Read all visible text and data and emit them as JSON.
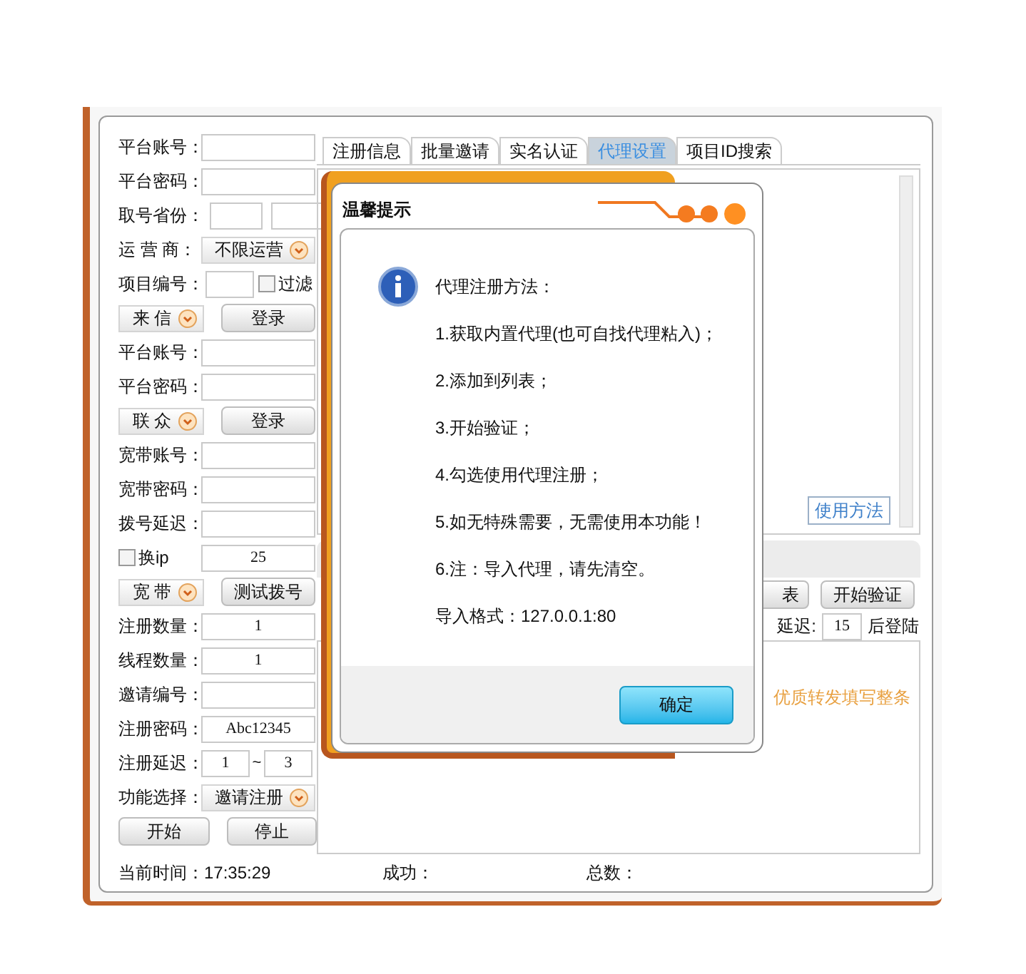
{
  "left_panel": {
    "rows": [
      {
        "kind": "field",
        "label": "平台账号："
      },
      {
        "kind": "field",
        "label": "平台密码："
      },
      {
        "kind": "pair",
        "label": "取号省份："
      },
      {
        "kind": "select",
        "label": "运 营 商：",
        "value": "不限运营"
      },
      {
        "kind": "field_check",
        "label": "项目编号：",
        "check_label": "过滤",
        "checked": false
      },
      {
        "kind": "select_button",
        "select": "来 信",
        "button": "登录"
      },
      {
        "kind": "field",
        "label": "平台账号："
      },
      {
        "kind": "field",
        "label": "平台密码："
      },
      {
        "kind": "select_button",
        "select": "联 众",
        "button": "登录"
      },
      {
        "kind": "field",
        "label": "宽带账号："
      },
      {
        "kind": "field",
        "label": "宽带密码："
      },
      {
        "kind": "field",
        "label": "拨号延迟："
      },
      {
        "kind": "check_field",
        "check_label": "换ip",
        "checked": false,
        "value": "25"
      },
      {
        "kind": "select_button",
        "select": "宽 带",
        "button": "测试拨号"
      },
      {
        "kind": "field",
        "label": "注册数量：",
        "value": "1"
      },
      {
        "kind": "field",
        "label": "线程数量：",
        "value": "1"
      },
      {
        "kind": "field",
        "label": "邀请编号："
      },
      {
        "kind": "field",
        "label": "注册密码：",
        "value": "Abc12345"
      },
      {
        "kind": "range",
        "label": "注册延迟：",
        "from": "1",
        "separator": "~",
        "to": "3"
      },
      {
        "kind": "select",
        "label": "功能选择：",
        "value": "邀请注册"
      },
      {
        "kind": "buttons",
        "buttons": [
          "开始",
          "停止"
        ]
      }
    ]
  },
  "tabs": [
    {
      "label": "注册信息",
      "selected": false
    },
    {
      "label": "批量邀请",
      "selected": false
    },
    {
      "label": "实名认证",
      "selected": false
    },
    {
      "label": "代理设置",
      "selected": true
    },
    {
      "label": "项目ID搜索",
      "selected": false
    }
  ],
  "proxy_panel": {
    "usage_button": "使用方法",
    "buttons": [
      "表",
      "开始验证"
    ],
    "delay_label": "延迟:",
    "delay_value": "15",
    "after_label": "后登陆",
    "notice": "优质转发填写整条"
  },
  "status_bar": {
    "time": "当前时间：17:35:29",
    "success": "成功：",
    "total": "总数："
  },
  "dialog": {
    "title": "温馨提示",
    "lines": [
      "代理注册方法：",
      "1.获取内置代理(也可自找代理粘入)；",
      "2.添加到列表；",
      "3.开始验证；",
      "4.勾选使用代理注册；",
      "5.如无特殊需要，无需使用本功能！",
      "6.注：导入代理，请先清空。",
      "导入格式：127.0.0.1:80"
    ],
    "ok_button": "确定"
  }
}
